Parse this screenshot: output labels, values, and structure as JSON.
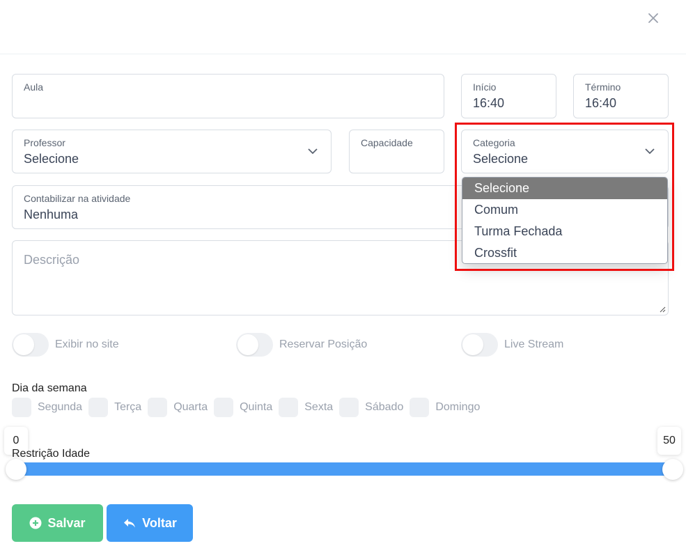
{
  "form": {
    "aula": {
      "label": "Aula",
      "value": ""
    },
    "inicio": {
      "label": "Início",
      "value": "16:40"
    },
    "termino": {
      "label": "Término",
      "value": "16:40"
    },
    "professor": {
      "label": "Professor",
      "value": "Selecione"
    },
    "capacidade": {
      "label": "Capacidade",
      "value": ""
    },
    "categoria": {
      "label": "Categoria",
      "value": "Selecione",
      "options": [
        "Selecione",
        "Comum",
        "Turma Fechada",
        "Crossfit"
      ],
      "selected_option": "Selecione"
    },
    "contabilizar": {
      "label": "Contabilizar na atividade",
      "value": "Nenhuma"
    },
    "descricao": {
      "placeholder": "Descrição",
      "value": ""
    }
  },
  "toggles": [
    {
      "label": "Exibir no site",
      "checked": false
    },
    {
      "label": "Reservar Posição",
      "checked": false
    },
    {
      "label": "Live Stream",
      "checked": false
    }
  ],
  "dias": {
    "title": "Dia da semana",
    "items": [
      "Segunda",
      "Terça",
      "Quarta",
      "Quinta",
      "Sexta",
      "Sábado",
      "Domingo"
    ]
  },
  "restricao": {
    "label": "Restrição Idade",
    "min": "0",
    "max": "50"
  },
  "buttons": {
    "save": "Salvar",
    "back": "Voltar"
  },
  "colors": {
    "accent_blue": "#409cf6",
    "save_green": "#56c98a",
    "slider_blue": "#4a9cf5",
    "highlight_red": "#ee1010",
    "selected_option_bg": "#7b7b7b"
  },
  "icons": {
    "close": "close-icon",
    "select": "chevron-down-icon",
    "save": "plus-circle-icon",
    "back": "reply-arrow-icon"
  }
}
